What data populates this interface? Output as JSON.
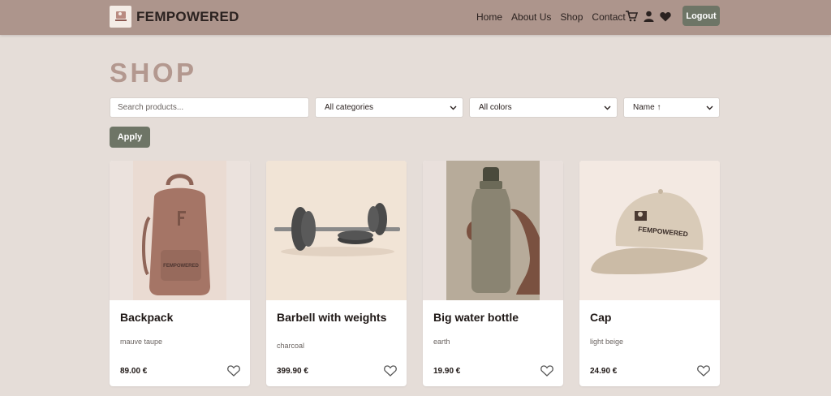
{
  "navbar": {
    "brand": "FEMPOWERED",
    "links": [
      "Home",
      "About Us",
      "Shop",
      "Contact"
    ],
    "icons": [
      "cart-icon",
      "user-icon",
      "heart-icon"
    ],
    "logout_label": "Logout"
  },
  "page": {
    "title": "SHOP"
  },
  "filters": {
    "search_placeholder": "Search products...",
    "category": "All categories",
    "color": "All colors",
    "sort": "Name ↑",
    "apply_label": "Apply"
  },
  "products": [
    {
      "name": "Backpack",
      "color": "mauve taupe",
      "price": "89.00 €"
    },
    {
      "name": "Barbell with weights",
      "color": "charcoal",
      "price": "399.90 €"
    },
    {
      "name": "Big water bottle",
      "color": "earth",
      "price": "19.90 €"
    },
    {
      "name": "Cap",
      "color": "light beige",
      "price": "24.90 €"
    }
  ],
  "colors": {
    "navbar": "#ad958c",
    "background": "#e5ddd8",
    "accent_button": "#6e7566",
    "title": "#b3988f"
  }
}
